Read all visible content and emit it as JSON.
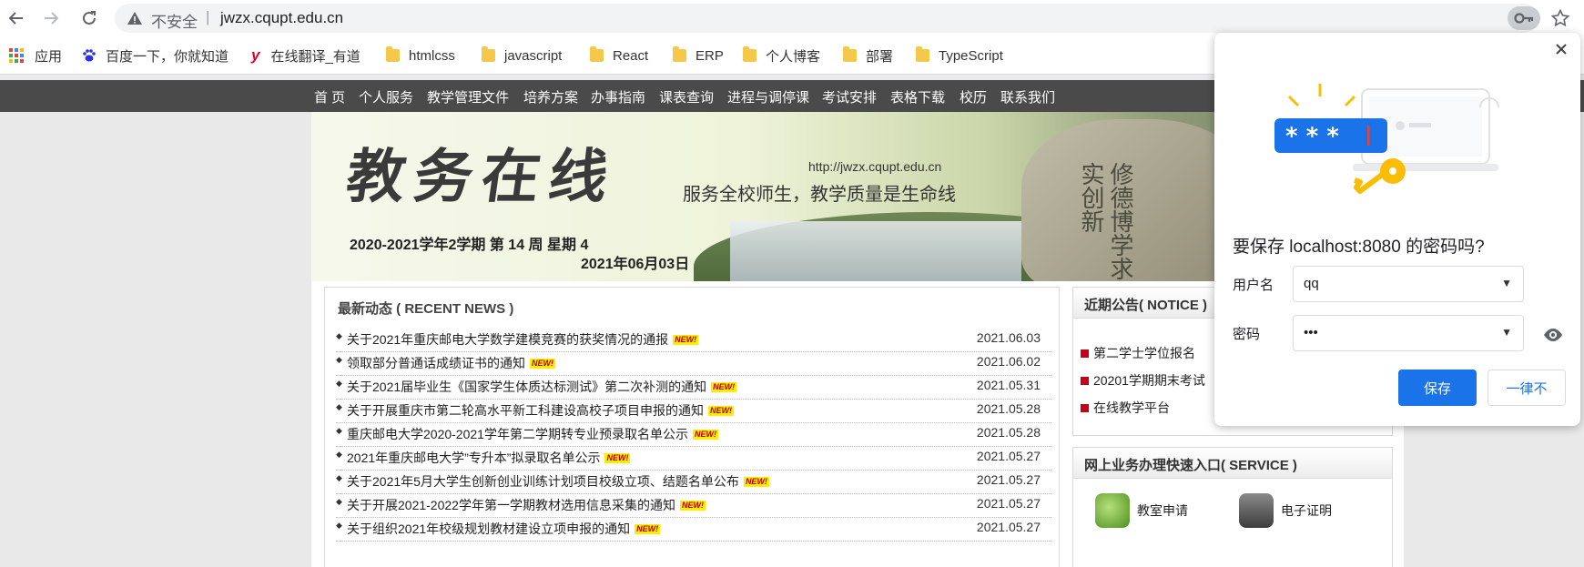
{
  "browser": {
    "security_warning": "不安全",
    "separator": "|",
    "url": "jwzx.cqupt.edu.cn"
  },
  "bookmarks": [
    {
      "label": "应用",
      "icon": "apps-grid-icon"
    },
    {
      "label": "百度一下，你就知道",
      "icon": "baidu-paw-icon"
    },
    {
      "label": "在线翻译_有道",
      "icon": "youdao-icon"
    },
    {
      "label": "htmlcss",
      "icon": "folder-icon"
    },
    {
      "label": "javascript",
      "icon": "folder-icon"
    },
    {
      "label": "React",
      "icon": "folder-icon"
    },
    {
      "label": "ERP",
      "icon": "folder-icon"
    },
    {
      "label": "个人博客",
      "icon": "folder-icon"
    },
    {
      "label": "部署",
      "icon": "folder-icon"
    },
    {
      "label": "TypeScript",
      "icon": "folder-icon"
    }
  ],
  "site_nav": [
    "首 页",
    "个人服务",
    "教学管理文件",
    "培养方案",
    "办事指南",
    "课表查询",
    "进程与调停课",
    "考试安排",
    "表格下载",
    "校历",
    "联系我们"
  ],
  "banner": {
    "logo_text": "教务在线",
    "url_text": "http://jwzx.cqupt.edu.cn",
    "slogan": "服务全校师生，教学质量是生命线",
    "term": "2020-2021学年2学期 第 14 周 星期 4",
    "date": "2021年06月03日",
    "carved_text": "修德博学求实创新"
  },
  "news": {
    "title": "最新动态 ( RECENT NEWS )",
    "badge": "NEW!",
    "items": [
      {
        "text": "关于2021年重庆邮电大学数学建模竞赛的获奖情况的通报",
        "date": "2021.06.03"
      },
      {
        "text": "领取部分普通话成绩证书的通知",
        "date": "2021.06.02"
      },
      {
        "text": "关于2021届毕业生《国家学生体质达标测试》第二次补测的通知",
        "date": "2021.05.31"
      },
      {
        "text": "关于开展重庆市第二轮高水平新工科建设高校子项目申报的通知",
        "date": "2021.05.28"
      },
      {
        "text": "重庆邮电大学2020-2021学年第二学期转专业预录取名单公示",
        "date": "2021.05.28"
      },
      {
        "text": "2021年重庆邮电大学”专升本”拟录取名单公示",
        "date": "2021.05.27"
      },
      {
        "text": "关于2021年5月大学生创新创业训练计划项目校级立项、结题名单公布",
        "date": "2021.05.27"
      },
      {
        "text": "关于开展2021-2022学年第一学期教材选用信息采集的通知",
        "date": "2021.05.27"
      },
      {
        "text": "关于组织2021年校级规划教材建设立项申报的通知",
        "date": "2021.05.27"
      }
    ]
  },
  "notice": {
    "title": "近期公告( NOTICE )",
    "items": [
      "第二学士学位报名",
      "20201学期期末考试",
      "在线教学平台"
    ]
  },
  "service": {
    "title": "网上业务办理快速入口( SERVICE )",
    "items": [
      {
        "label": "教室申请",
        "icon": "phone-booth-icon"
      },
      {
        "label": "电子证明",
        "icon": "printer-icon"
      }
    ]
  },
  "password_popup": {
    "question": "要保存 localhost:8080 的密码吗?",
    "username_label": "用户名",
    "username_value": "qq",
    "password_label": "密码",
    "password_value": "•••",
    "save_label": "保存",
    "never_label": "一律不",
    "illustration_text": "* * *"
  }
}
